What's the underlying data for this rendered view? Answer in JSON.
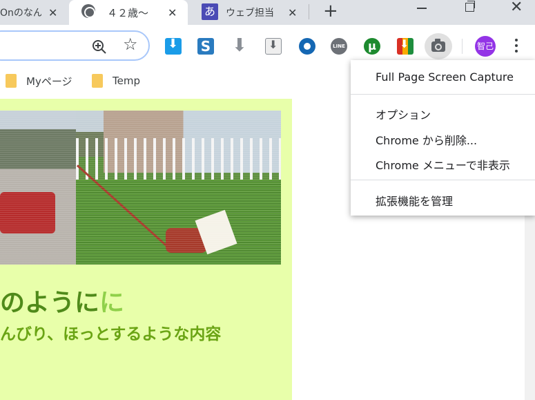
{
  "tabs": [
    {
      "title": "Onのなん",
      "close": "✕",
      "favicon": ""
    },
    {
      "title": "４２歳〜",
      "close": "✕",
      "favicon": "globe-icon"
    },
    {
      "title": "ウェブ担当",
      "close": "✕",
      "favicon": "あ"
    }
  ],
  "tabstrip": {
    "new_tab": "+"
  },
  "window": {
    "minimize": "",
    "maximize": "",
    "close": "✕"
  },
  "toolbar": {
    "avatar": "智己",
    "extensions": [
      "download-icon",
      "s-icon",
      "arrow-down-icon",
      "save-page-icon",
      "bluetooth-icon",
      "line-icon",
      "utorrent-icon",
      "color-download-icon",
      "camera-icon"
    ],
    "ext_s": "S",
    "ext_line": "LINE",
    "ext_utorrent": "μ"
  },
  "bookmarks": [
    {
      "label": "Myページ"
    },
    {
      "label": "Temp"
    }
  ],
  "page": {
    "heading_main": "のように",
    "heading_glow": "に",
    "subheading": "んびり、ほっとするような内容"
  },
  "context_menu": {
    "items": [
      {
        "label": "Full Page Screen Capture"
      },
      {
        "label": "オプション"
      },
      {
        "label": "Chrome から削除..."
      },
      {
        "label": "Chrome メニューで非表示"
      },
      {
        "label": "拡張機能を管理"
      }
    ]
  },
  "colors": {
    "panel_bg": "#e8ffaa",
    "heading": "#4f8a1a",
    "subheading": "#6aa414",
    "avatar_bg": "#9334e6"
  }
}
